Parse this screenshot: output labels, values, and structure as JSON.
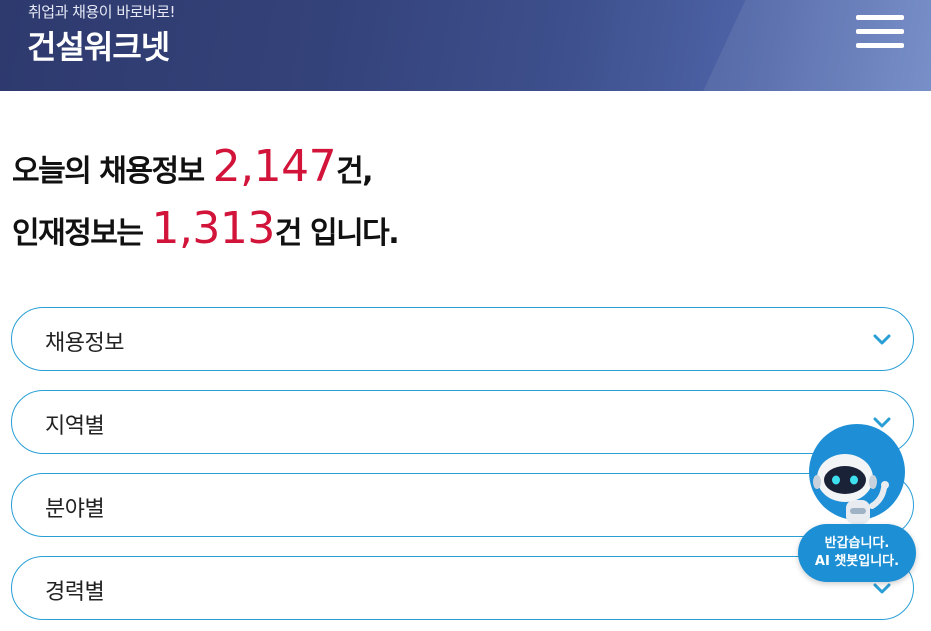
{
  "header": {
    "tagline": "취업과 채용이 바로바로!",
    "logo": "건설워크넷",
    "menu_icon": "hamburger-menu-icon"
  },
  "headline": {
    "line1_prefix": "오늘의 채용정보 ",
    "job_count": "2,147",
    "line1_suffix": "건,",
    "line2_prefix": "인재정보는 ",
    "talent_count": "1,313",
    "line2_suffix": "건 입니다."
  },
  "accordion": [
    {
      "label": "채용정보",
      "icon": "chevron-down-icon"
    },
    {
      "label": "지역별",
      "icon": "chevron-down-icon"
    },
    {
      "label": "분야별",
      "icon": "chevron-down-icon"
    },
    {
      "label": "경력별",
      "icon": "chevron-down-icon"
    }
  ],
  "chatbot": {
    "line1": "반갑습니다.",
    "line2": "AI 챗봇입니다.",
    "icon": "robot-icon"
  },
  "colors": {
    "header": "#34427a",
    "accent_red": "#d2143a",
    "accent_blue": "#2a9fd6",
    "chat_blue": "#1d8fd4"
  }
}
